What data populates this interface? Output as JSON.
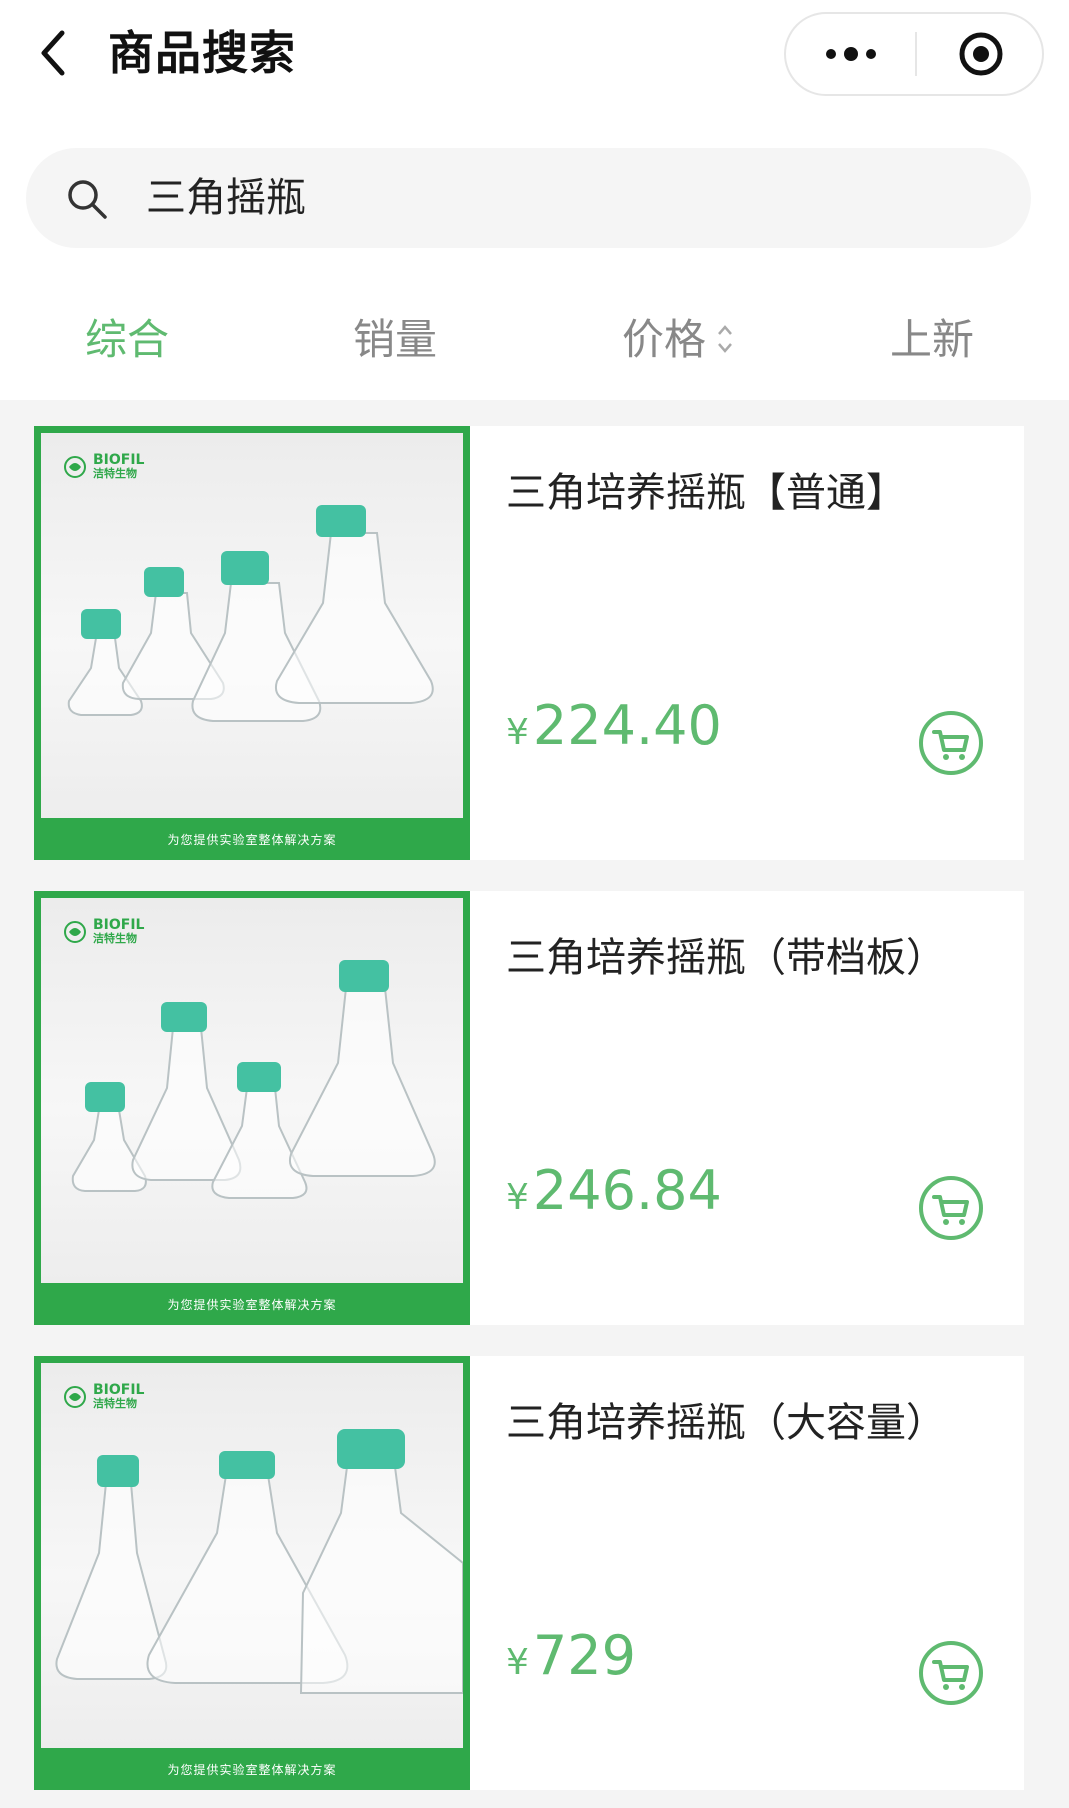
{
  "header": {
    "title": "商品搜索",
    "back_icon": "chevron-left-icon",
    "more_icon": "more-icon",
    "close_icon": "target-close-icon"
  },
  "search": {
    "value": "三角摇瓶",
    "icon": "search-icon"
  },
  "tabs": [
    {
      "label": "综合",
      "active": true
    },
    {
      "label": "销量",
      "active": false
    },
    {
      "label": "价格",
      "active": false,
      "sortable": true
    },
    {
      "label": "上新",
      "active": false
    }
  ],
  "colors": {
    "accent": "#5fba70",
    "brand_green": "#2fa84a",
    "background": "#f4f4f4",
    "cap_teal": "#44c1a2"
  },
  "products": [
    {
      "name": "三角培养摇瓶【普通】",
      "currency": "¥",
      "price": "224.40",
      "brand": "BIOFIL",
      "brand_cn": "洁特生物",
      "banner": "为您提供实验室整体解决方案"
    },
    {
      "name": "三角培养摇瓶（带档板）",
      "currency": "¥",
      "price": "246.84",
      "brand": "BIOFIL",
      "brand_cn": "洁特生物",
      "banner": "为您提供实验室整体解决方案"
    },
    {
      "name": "三角培养摇瓶（大容量）",
      "currency": "¥",
      "price": "729",
      "brand": "BIOFIL",
      "brand_cn": "洁特生物",
      "banner": "为您提供实验室整体解决方案"
    }
  ]
}
